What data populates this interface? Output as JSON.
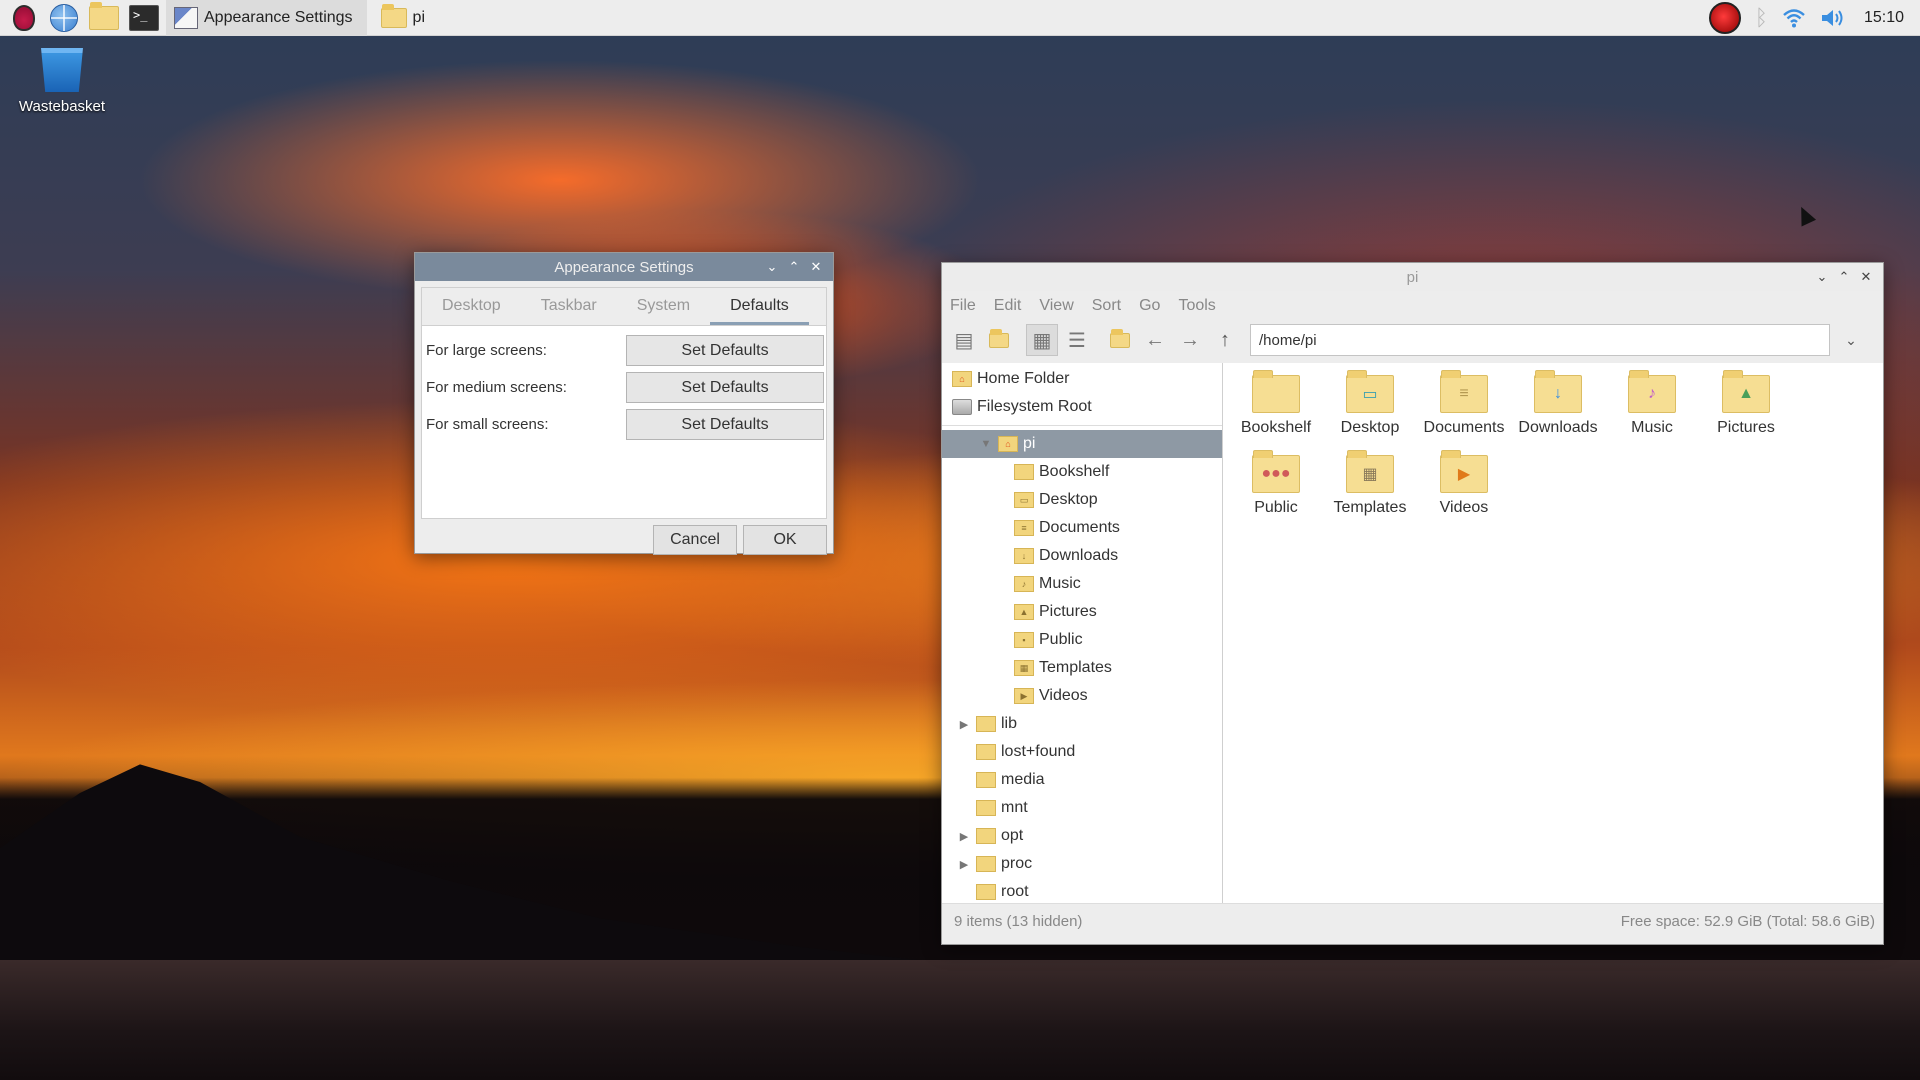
{
  "taskbar": {
    "launchers": [
      {
        "icon": "raspberry-pi-menu-icon"
      },
      {
        "icon": "web-browser-icon"
      },
      {
        "icon": "file-manager-icon"
      },
      {
        "icon": "terminal-icon"
      }
    ],
    "tasks": [
      {
        "label": "Appearance Settings",
        "icon": "appearance-settings-icon",
        "active": true
      },
      {
        "label": "pi",
        "icon": "folder-icon",
        "active": false
      }
    ],
    "tray": {
      "icons": [
        "record-icon",
        "bluetooth-icon",
        "wifi-icon",
        "volume-icon"
      ],
      "clock": "15:10"
    }
  },
  "desktop": {
    "icons": [
      {
        "label": "Wastebasket",
        "icon": "wastebasket-icon"
      }
    ]
  },
  "appearance_settings": {
    "title": "Appearance Settings",
    "tabs": [
      {
        "label": "Desktop",
        "active": false
      },
      {
        "label": "Taskbar",
        "active": false
      },
      {
        "label": "System",
        "active": false
      },
      {
        "label": "Defaults",
        "active": true
      }
    ],
    "rows": [
      {
        "label": "For large screens:",
        "button": "Set Defaults"
      },
      {
        "label": "For medium screens:",
        "button": "Set Defaults"
      },
      {
        "label": "For small screens:",
        "button": "Set Defaults"
      }
    ],
    "buttons": {
      "cancel": "Cancel",
      "ok": "OK"
    }
  },
  "file_manager": {
    "title": "pi",
    "menus": [
      "File",
      "Edit",
      "View",
      "Sort",
      "Go",
      "Tools"
    ],
    "path": "/home/pi",
    "places": [
      {
        "label": "Home Folder",
        "icon": "home-folder-icon"
      },
      {
        "label": "Filesystem Root",
        "icon": "drive-icon"
      }
    ],
    "tree": [
      {
        "label": "pi",
        "level": 1,
        "expander": "open",
        "selected": true,
        "icon": "home"
      },
      {
        "label": "Bookshelf",
        "level": 2,
        "expander": "",
        "selected": false,
        "icon": ""
      },
      {
        "label": "Desktop",
        "level": 2,
        "expander": "",
        "selected": false,
        "icon": "▭"
      },
      {
        "label": "Documents",
        "level": 2,
        "expander": "",
        "selected": false,
        "icon": "≡"
      },
      {
        "label": "Downloads",
        "level": 2,
        "expander": "",
        "selected": false,
        "icon": "↓"
      },
      {
        "label": "Music",
        "level": 2,
        "expander": "",
        "selected": false,
        "icon": "♪"
      },
      {
        "label": "Pictures",
        "level": 2,
        "expander": "",
        "selected": false,
        "icon": "▲"
      },
      {
        "label": "Public",
        "level": 2,
        "expander": "",
        "selected": false,
        "icon": "▪"
      },
      {
        "label": "Templates",
        "level": 2,
        "expander": "",
        "selected": false,
        "icon": "▦"
      },
      {
        "label": "Videos",
        "level": 2,
        "expander": "",
        "selected": false,
        "icon": "▶"
      },
      {
        "label": "lib",
        "level": 0,
        "expander": "closed",
        "selected": false,
        "icon": ""
      },
      {
        "label": "lost+found",
        "level": 0,
        "expander": "",
        "selected": false,
        "icon": ""
      },
      {
        "label": "media",
        "level": 0,
        "expander": "",
        "selected": false,
        "icon": ""
      },
      {
        "label": "mnt",
        "level": 0,
        "expander": "",
        "selected": false,
        "icon": ""
      },
      {
        "label": "opt",
        "level": 0,
        "expander": "closed",
        "selected": false,
        "icon": ""
      },
      {
        "label": "proc",
        "level": 0,
        "expander": "closed",
        "selected": false,
        "icon": ""
      },
      {
        "label": "root",
        "level": 0,
        "expander": "",
        "selected": false,
        "icon": ""
      }
    ],
    "items": [
      {
        "label": "Bookshelf",
        "glyph": "",
        "color": "#f6de93"
      },
      {
        "label": "Desktop",
        "glyph": "▭",
        "color": "#3a9fb0"
      },
      {
        "label": "Documents",
        "glyph": "≡",
        "color": "#b59a52"
      },
      {
        "label": "Downloads",
        "glyph": "↓",
        "color": "#3a8ee0"
      },
      {
        "label": "Music",
        "glyph": "♪",
        "color": "#c05cc8"
      },
      {
        "label": "Pictures",
        "glyph": "▲",
        "color": "#4aa05a"
      },
      {
        "label": "Public",
        "glyph": "●●●",
        "color": "#d05a5a"
      },
      {
        "label": "Templates",
        "glyph": "▦",
        "color": "#8a7a5a"
      },
      {
        "label": "Videos",
        "glyph": "▶",
        "color": "#e07a1a"
      }
    ],
    "status_left": "9 items (13 hidden)",
    "status_right": "Free space: 52.9 GiB (Total: 58.6 GiB)"
  }
}
